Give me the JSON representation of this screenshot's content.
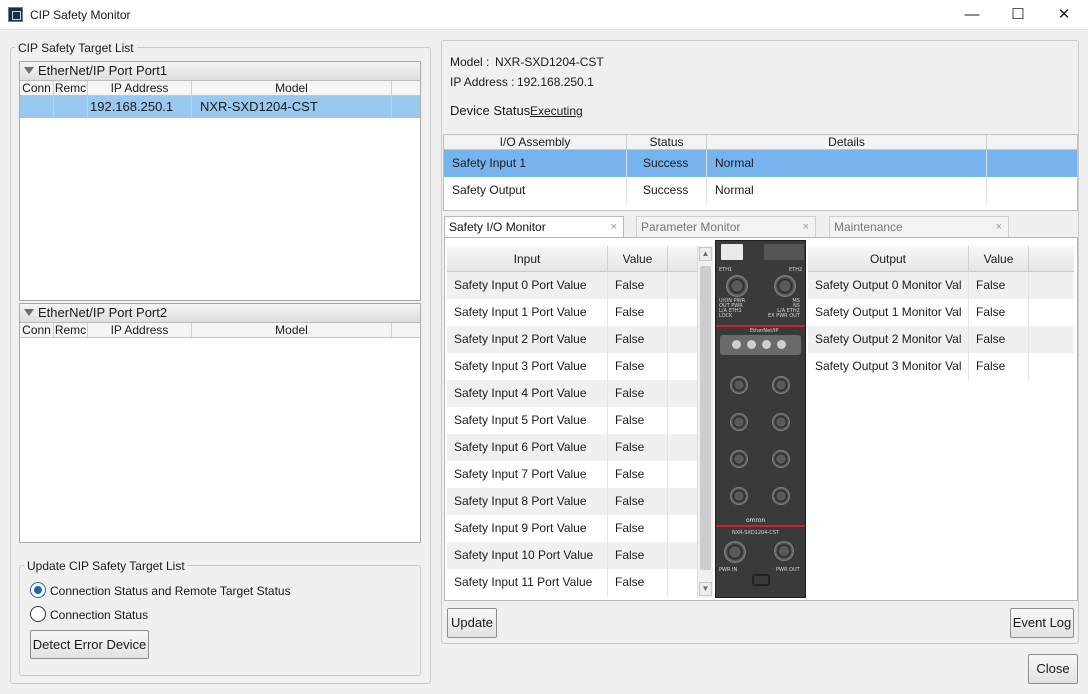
{
  "window": {
    "title": "CIP Safety Monitor",
    "minimize": "—",
    "maximize": "☐",
    "close": "✕"
  },
  "left": {
    "group_title": "CIP Safety Target List",
    "port1": {
      "title": "EtherNet/IP Port Port1",
      "columns": [
        "Conn",
        "Remc",
        "IP Address",
        "Model"
      ],
      "rows": [
        {
          "ip": "192.168.250.1",
          "model": "NXR-SXD1204-CST"
        }
      ]
    },
    "port2": {
      "title": "EtherNet/IP Port Port2",
      "columns": [
        "Conn",
        "Remc",
        "IP Address",
        "Model"
      ]
    },
    "update_group": {
      "title": "Update CIP Safety Target List",
      "options": [
        {
          "label": "Connection Status and Remote Target Status",
          "selected": true
        },
        {
          "label": "Connection Status",
          "selected": false
        }
      ],
      "detect_button": "Detect Error Device"
    }
  },
  "right": {
    "model_label": "Model :",
    "model_value": "NXR-SXD1204-CST",
    "ip_label": "IP Address :",
    "ip_value": "192.168.250.1",
    "status_label": "Device Status",
    "status_value": "Executing",
    "assembly": {
      "columns": [
        "I/O Assembly",
        "Status",
        "Details"
      ],
      "rows": [
        {
          "assembly": "Safety Input 1",
          "status": "Success",
          "details": "Normal",
          "selected": true
        },
        {
          "assembly": "Safety Output",
          "status": "Success",
          "details": "Normal",
          "selected": false
        }
      ]
    },
    "tabs": [
      {
        "label": "Safety I/O Monitor",
        "active": true
      },
      {
        "label": "Parameter Monitor",
        "active": false
      },
      {
        "label": "Maintenance",
        "active": false
      }
    ],
    "tab_close": "×",
    "input_table": {
      "columns": [
        "Input",
        "Value"
      ],
      "rows": [
        {
          "name": "Safety Input 0 Port Value",
          "value": "False"
        },
        {
          "name": "Safety Input 1 Port Value",
          "value": "False"
        },
        {
          "name": "Safety Input 2 Port Value",
          "value": "False"
        },
        {
          "name": "Safety Input 3 Port Value",
          "value": "False"
        },
        {
          "name": "Safety Input 4 Port Value",
          "value": "False"
        },
        {
          "name": "Safety Input 5 Port Value",
          "value": "False"
        },
        {
          "name": "Safety Input 6 Port Value",
          "value": "False"
        },
        {
          "name": "Safety Input 7 Port Value",
          "value": "False"
        },
        {
          "name": "Safety Input 8 Port Value",
          "value": "False"
        },
        {
          "name": "Safety Input 9 Port Value",
          "value": "False"
        },
        {
          "name": "Safety Input 10 Port Value",
          "value": "False"
        },
        {
          "name": "Safety Input 11 Port Value",
          "value": "False"
        }
      ]
    },
    "output_table": {
      "columns": [
        "Output",
        "Value"
      ],
      "rows": [
        {
          "name": "Safety Output 0 Monitor Val",
          "value": "False"
        },
        {
          "name": "Safety Output 1 Monitor Val",
          "value": "False"
        },
        {
          "name": "Safety Output 2 Monitor Val",
          "value": "False"
        },
        {
          "name": "Safety Output 3 Monitor Val",
          "value": "False"
        }
      ]
    },
    "device_image": {
      "labels": {
        "eth1": "ETH1",
        "eth2": "ETH2",
        "left_leds": "U/ON PWR\nOUT PWR\nL/A ETH1\nLOCK",
        "right_leds": "MS\nNS\nL/A ETH2\nEX PWR OUT",
        "brand_strip": "EtherNet/IP",
        "brand": "omron",
        "model": "NXR-SXD1204-CST",
        "pwr_in": "PWR IN",
        "pwr_out": "PWR OUT"
      }
    },
    "update_button": "Update",
    "event_log_button": "Event Log"
  },
  "close_button": "Close",
  "colors": {
    "selection": "#99c9f0",
    "assembly_selection": "#77b4ee",
    "radio_accent": "#1e65b4",
    "device_red": "#c8242e"
  }
}
